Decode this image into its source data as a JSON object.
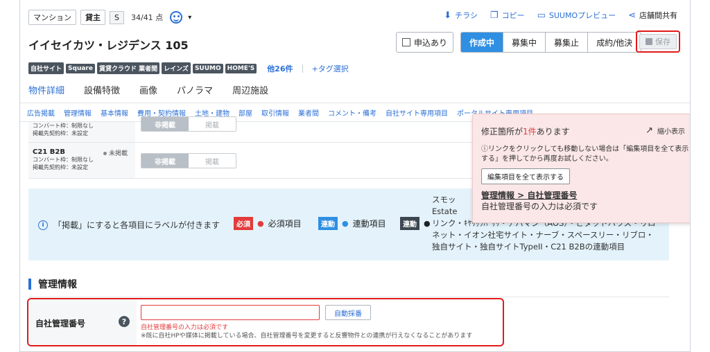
{
  "header": {
    "type_label": "マンション",
    "deal_label": "貸主",
    "grade_label": "S",
    "points": "34/41 点",
    "title": "イイセイカツ・レジデンス 105"
  },
  "actions": [
    {
      "label": "チラシ",
      "icon": "download-icon"
    },
    {
      "label": "コピー",
      "icon": "copy-icon"
    },
    {
      "label": "SUUMOプレビュー",
      "icon": "monitor-icon"
    },
    {
      "label": "店舗間共有",
      "icon": "share-icon"
    }
  ],
  "status": {
    "applied_label": "申込あり",
    "segments": [
      "作成中",
      "募集中",
      "募集止",
      "成約/他決"
    ],
    "active": "作成中",
    "save_label": "保存"
  },
  "tags": {
    "chips": [
      "自社サイト",
      "Square",
      "賃貸クラウド 業者間",
      "レインズ",
      "SUUMO",
      "HOME'S"
    ],
    "more": "他26件",
    "select": "+タグ選択"
  },
  "tabs": [
    "物件詳細",
    "設備特徴",
    "画像",
    "パノラマ",
    "周辺施設"
  ],
  "subnav": [
    "広告掲載",
    "管理情報",
    "基本情報",
    "費用・契約情報",
    "土地・建物",
    "部屋",
    "取引情報",
    "業者間",
    "コメント・備考",
    "自社サイト専用項目",
    "ポータルサイト専用項目"
  ],
  "media_rows": [
    {
      "name": "",
      "line1": "コンバート枠：制限なし",
      "line2": "掲載先契約枠：未設定",
      "state": "",
      "off": "非掲載",
      "on": "掲載"
    },
    {
      "name": "C21 B2B",
      "line1": "コンバート枠：制限なし",
      "line2": "掲載先契約枠：未設定",
      "state": "未掲載",
      "off": "非掲載",
      "on": "掲載"
    }
  ],
  "info": {
    "message": "「掲載」にすると各項目にラベルが付きます",
    "required_badge": "必須",
    "required_label": "必須項目",
    "linked_badge": "連動",
    "linked_label": "連動項目",
    "sync_badge": "連動",
    "sync_line1": "スモッ",
    "sync_line2": "Estate",
    "sync_line3": "リンク・ｷﾔﾘｯｸﾊﾟｻﾘ・アパマン（AOS）・ピタットハウス・リロ",
    "sync_line4": "ネット・イオン社宅サイト・ナーブ・スペースリー・リブロ・",
    "sync_line5": "独自サイト・独自サイトTypeII・C21 B2Bの連動項目"
  },
  "section": {
    "title": "管理情報"
  },
  "field": {
    "label": "自社管理番号",
    "value": "",
    "auto_button": "自動採番",
    "error": "自社管理番号の入力は必須です",
    "note": "※既に自社HPや媒体に掲載している場合、自社管理番号を変更すると反響物件との連携が行えなくなることがあります"
  },
  "popup": {
    "head_prefix": "修正箇所が",
    "count": "1件",
    "head_suffix": "あります",
    "minimize": "縮小表示",
    "note": "ⓘリンクをクリックしても移動しない場合は「編集項目を全て表示する」を押してから再度お試しください。",
    "show_all": "編集項目を全て表示する",
    "link": "管理情報 > 自社管理番号",
    "desc": "自社管理番号の入力は必須です"
  }
}
